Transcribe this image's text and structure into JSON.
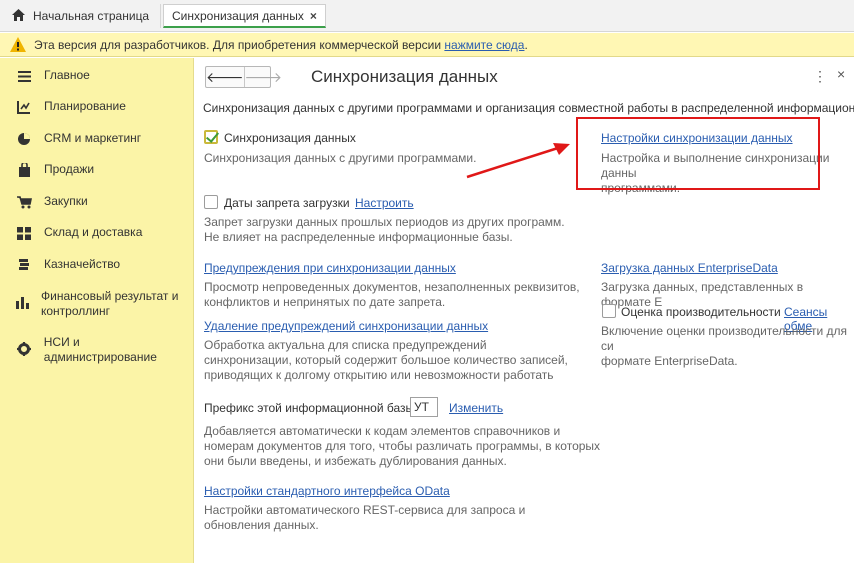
{
  "tabs": {
    "home_label": "Начальная страница",
    "active_label": "Синхронизация данных",
    "close_glyph": "×"
  },
  "dev_banner": {
    "text": "Эта версия для разработчиков. Для приобретения коммерческой версии",
    "link": "нажмите сюда",
    "period": "."
  },
  "sidebar": {
    "items": [
      {
        "label": "Главное",
        "icon": "menu-icon"
      },
      {
        "label": "Планирование",
        "icon": "planning-icon"
      },
      {
        "label": "CRM и маркетинг",
        "icon": "crm-icon"
      },
      {
        "label": "Продажи",
        "icon": "sales-bag-icon"
      },
      {
        "label": "Закупки",
        "icon": "cart-icon"
      },
      {
        "label": "Склад и доставка",
        "icon": "warehouse-icon"
      },
      {
        "label": "Казначейство",
        "icon": "treasury-icon"
      },
      {
        "label": "Финансовый результат и контроллинг",
        "icon": "bar-chart-icon"
      },
      {
        "label": "НСИ и администрирование",
        "icon": "gear-icon"
      }
    ]
  },
  "main": {
    "title": "Синхронизация данных",
    "description": "Синхронизация данных с другими программами и организация совместной работы в распределенной информационной",
    "sync": {
      "label": "Синхронизация данных",
      "checked": true,
      "hint": "Синхронизация данных с другими программами."
    },
    "sync_settings": {
      "link": "Настройки синхронизации данных",
      "hint_line1": "Настройка и выполнение синхронизации данны",
      "hint_line2": "программами."
    },
    "ban_dates": {
      "label": "Даты запрета загрузки",
      "configure": "Настроить",
      "checked": false,
      "hint_line1": "Запрет загрузки данных прошлых периодов из других программ.",
      "hint_line2": "Не влияет на распределенные информационные базы."
    },
    "warnings": {
      "link": "Предупреждения при синхронизации данных",
      "hint_line1": "Просмотр непроведенных документов, незаполненных реквизитов,",
      "hint_line2": "конфликтов и непринятых по дате запрета."
    },
    "delete_warnings": {
      "link": "Удаление предупреждений синхронизации данных",
      "hint_line1": "Обработка актуальна для списка предупреждений",
      "hint_line2": "синхронизации, который содержит большое количество записей,",
      "hint_line3": "приводящих к долгому открытию или невозможности работать"
    },
    "prefix": {
      "label": "Префикс этой информационной базы:",
      "value": "УТ",
      "change": "Изменить",
      "hint_line1": "Добавляется автоматически к кодам элементов справочников и",
      "hint_line2": "номерам документов для того, чтобы различать программы, в которых",
      "hint_line3": "они были введены, и избежать дублирования данных."
    },
    "odata": {
      "link": "Настройки стандартного интерфейса OData",
      "hint_line1": "Настройки автоматического REST-сервиса для запроса и",
      "hint_line2": "обновления данных."
    },
    "enterprise_data": {
      "link": "Загрузка данных EnterpriseData",
      "hint": "Загрузка данных, представленных в формате E"
    },
    "performance": {
      "label": "Оценка производительности",
      "sessions": "Сеансы обме",
      "checked": false,
      "hint_line1": "Включение оценки производительности для си",
      "hint_line2": "формате EnterpriseData."
    }
  },
  "colors": {
    "sidebar_bg": "#fbf4a7",
    "banner_bg": "#fff7b4",
    "link": "#2a5db0",
    "highlight": "#e01818",
    "tab_accent": "#3ca04b"
  }
}
